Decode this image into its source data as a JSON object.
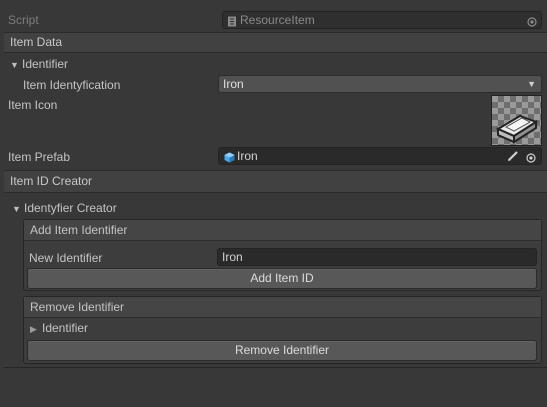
{
  "script_row": {
    "label": "Script",
    "value": "ResourceItem"
  },
  "item_data": {
    "header": "Item Data",
    "identifier_foldout": "Identifier",
    "identification_label": "Item Identyfication",
    "identification_value": "Iron",
    "icon_label": "Item Icon",
    "prefab_label": "Item Prefab",
    "prefab_value": "Iron"
  },
  "id_creator": {
    "header": "Item ID Creator",
    "creator_foldout": "Identyfier Creator",
    "add_section": {
      "title": "Add Item Identifier",
      "new_label": "New Identifier",
      "new_value": "Iron",
      "button": "Add Item ID"
    },
    "remove_section": {
      "title": "Remove Identifier",
      "foldout": "Identifier",
      "button": "Remove Identifier"
    }
  },
  "icons": [
    "script-icon",
    "object-picker-icon",
    "dropdown-arrow-icon",
    "iron-ingot-icon",
    "prefab-cube-icon",
    "pencil-icon",
    "foldout-expanded-icon",
    "foldout-collapsed-icon"
  ],
  "colors": {
    "background": "#383838",
    "field": "#2a2a2a",
    "button": "#585858",
    "prefab_cube": "#4aa8e8"
  }
}
